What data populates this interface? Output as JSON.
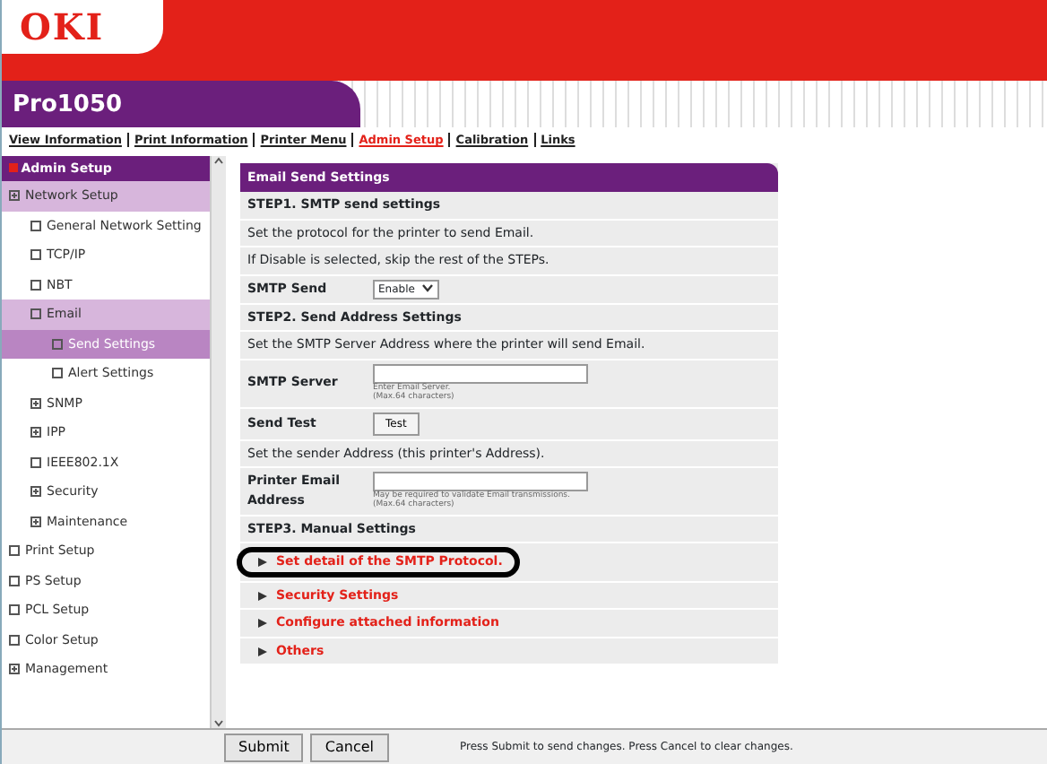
{
  "header": {
    "logo": "OKI",
    "model": "Pro1050"
  },
  "nav": [
    {
      "label": "View Information",
      "selected": false
    },
    {
      "label": "Print Information",
      "selected": false
    },
    {
      "label": "Printer Menu",
      "selected": false
    },
    {
      "label": "Admin Setup",
      "selected": true
    },
    {
      "label": "Calibration",
      "selected": false
    },
    {
      "label": "Links",
      "selected": false
    }
  ],
  "sidebar": {
    "title": "Admin Setup",
    "items": [
      {
        "label": "Network Setup",
        "expandable": true,
        "expanded": true,
        "selected": false,
        "children": [
          {
            "label": "General Network Setting",
            "expandable": false,
            "expanded": false,
            "selected": false
          },
          {
            "label": "TCP/IP",
            "expandable": false,
            "expanded": false,
            "selected": false
          },
          {
            "label": "NBT",
            "expandable": false,
            "expanded": false,
            "selected": false
          },
          {
            "label": "Email",
            "expandable": false,
            "expanded": true,
            "selected": false,
            "children": [
              {
                "label": "Send Settings",
                "expandable": false,
                "expanded": false,
                "selected": true
              },
              {
                "label": "Alert Settings",
                "expandable": false,
                "expanded": false,
                "selected": false
              }
            ]
          },
          {
            "label": "SNMP",
            "expandable": true,
            "expanded": false,
            "selected": false
          },
          {
            "label": "IPP",
            "expandable": true,
            "expanded": false,
            "selected": false
          },
          {
            "label": "IEEE802.1X",
            "expandable": false,
            "expanded": false,
            "selected": false
          },
          {
            "label": "Security",
            "expandable": true,
            "expanded": false,
            "selected": false
          },
          {
            "label": "Maintenance",
            "expandable": true,
            "expanded": false,
            "selected": false
          }
        ]
      },
      {
        "label": "Print Setup",
        "expandable": false,
        "expanded": false,
        "selected": false
      },
      {
        "label": "PS Setup",
        "expandable": false,
        "expanded": false,
        "selected": false
      },
      {
        "label": "PCL Setup",
        "expandable": false,
        "expanded": false,
        "selected": false
      },
      {
        "label": "Color Setup",
        "expandable": false,
        "expanded": false,
        "selected": false
      },
      {
        "label": "Management",
        "expandable": true,
        "expanded": false,
        "selected": false
      }
    ]
  },
  "panel": {
    "title": "Email Send Settings",
    "rows": [
      {
        "kind": "heading",
        "text": "STEP1. SMTP send settings"
      },
      {
        "kind": "note",
        "text": "Set the protocol for the printer to send Email."
      },
      {
        "kind": "note",
        "text": "If Disable is selected, skip the rest of the STEPs."
      },
      {
        "kind": "select",
        "label": "SMTP Send",
        "value": "Enable"
      },
      {
        "kind": "heading",
        "text": "STEP2. Send Address Settings"
      },
      {
        "kind": "note",
        "text": "Set the SMTP Server Address where the printer will send Email."
      },
      {
        "kind": "field",
        "label": "SMTP Server",
        "hint": "Enter Email Server.",
        "limit": "(Max.64 characters)"
      },
      {
        "kind": "button",
        "label": "Send Test",
        "button": "Test"
      },
      {
        "kind": "note",
        "text": "Set the sender Address (this printer's Address)."
      },
      {
        "kind": "field",
        "label": "Printer Email Address",
        "hint": "May be required to validate Email transmissions.",
        "limit": "(Max.64 characters)"
      },
      {
        "kind": "heading",
        "text": "STEP3. Manual Settings"
      },
      {
        "kind": "link",
        "text": "Set detail of the SMTP Protocol.",
        "circled": true
      },
      {
        "kind": "link",
        "text": "Security Settings",
        "circled": false
      },
      {
        "kind": "link",
        "text": "Configure attached information",
        "circled": false
      },
      {
        "kind": "link",
        "text": "Others",
        "circled": false
      }
    ]
  },
  "footer": {
    "buttons": [
      "Submit",
      "Cancel"
    ],
    "message": "Press Submit to send changes. Press Cancel to clear changes."
  }
}
